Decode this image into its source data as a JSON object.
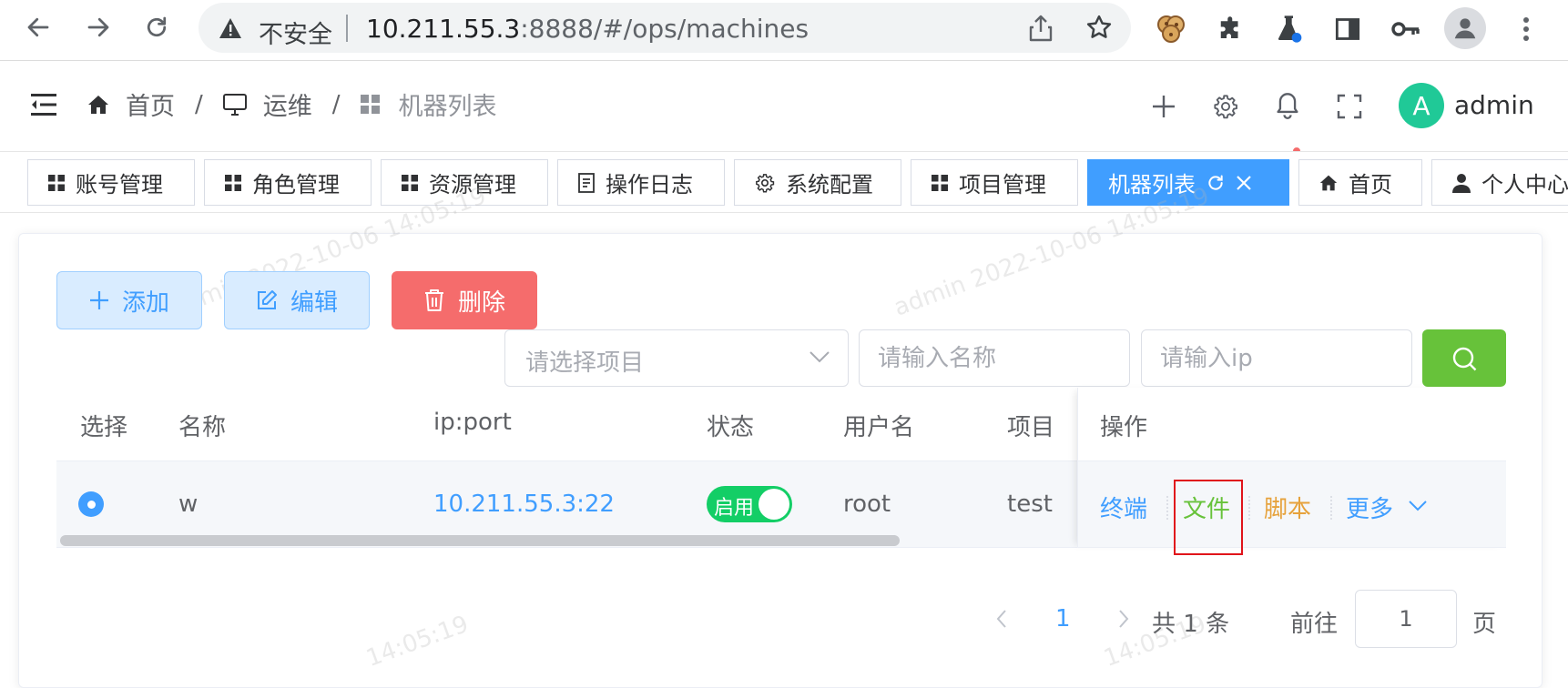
{
  "browser": {
    "insecure_label": "不安全",
    "url_host": "10.211.55.3",
    "url_path": ":8888/#/ops/machines"
  },
  "header": {
    "breadcrumb": [
      "首页",
      "运维",
      "机器列表"
    ],
    "breadcrumb_sep": "/",
    "avatar_letter": "A",
    "username": "admin"
  },
  "tags": [
    {
      "label": "账号管理",
      "icon": "grid-icon"
    },
    {
      "label": "角色管理",
      "icon": "grid-icon"
    },
    {
      "label": "资源管理",
      "icon": "grid-icon"
    },
    {
      "label": "操作日志",
      "icon": "document-icon"
    },
    {
      "label": "系统配置",
      "icon": "gear-icon"
    },
    {
      "label": "项目管理",
      "icon": "grid-icon"
    },
    {
      "label": "机器列表",
      "icon": "",
      "active": true
    },
    {
      "label": "首页",
      "icon": "home-icon"
    },
    {
      "label": "个人中心",
      "icon": "user-icon"
    }
  ],
  "toolbar": {
    "add_label": "添加",
    "edit_label": "编辑",
    "delete_label": "删除"
  },
  "filters": {
    "project_placeholder": "请选择项目",
    "name_placeholder": "请输入名称",
    "ip_placeholder": "请输入ip"
  },
  "table": {
    "columns": [
      "选择",
      "名称",
      "ip:port",
      "状态",
      "用户名",
      "项目",
      "操作"
    ],
    "rows": [
      {
        "name": "w",
        "ip_port": "10.211.55.3:22",
        "status": "启用",
        "status_on": true,
        "username": "root",
        "project": "test"
      }
    ],
    "actions": {
      "terminal": "终端",
      "file": "文件",
      "script": "脚本",
      "more": "更多"
    }
  },
  "pagination": {
    "current_page": "1",
    "total_text": "共 1 条",
    "goto_label": "前往",
    "goto_value": "1",
    "page_suffix": "页"
  },
  "watermark": "admin 2022-10-06 14:05:19",
  "watermark_partial": "14:05:19",
  "colors": {
    "primary": "#409eff",
    "success": "#67c23a",
    "danger": "#f56c6c",
    "warning": "#e6a23c",
    "switch_on": "#13ce66",
    "highlight": "#e0141b"
  }
}
